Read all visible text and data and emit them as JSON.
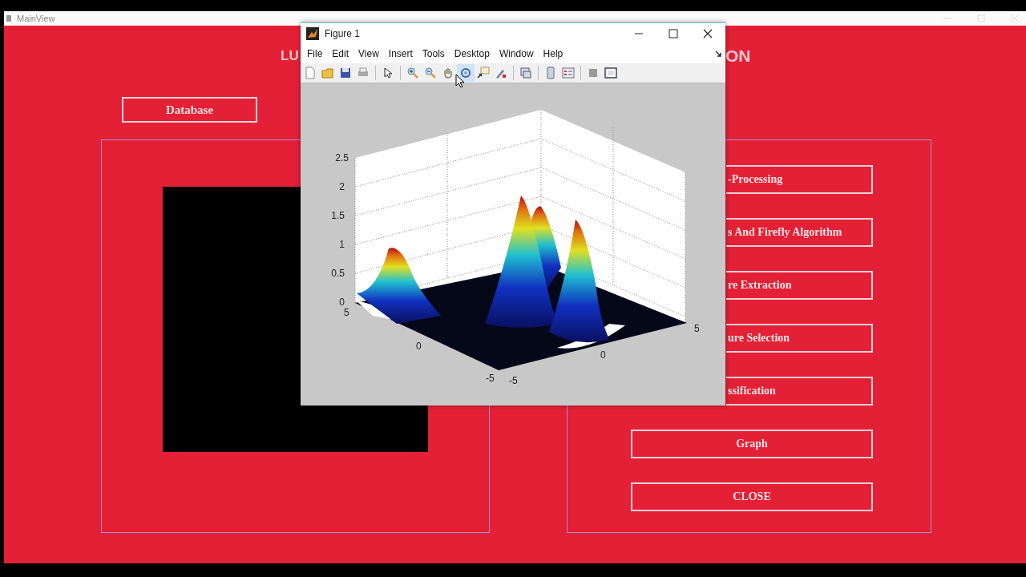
{
  "main_window": {
    "title": "MainView"
  },
  "app_title": {
    "left": "LU",
    "right": "ON"
  },
  "database_button": {
    "label": "Database"
  },
  "actions": [
    {
      "label": "-Processing",
      "covered": true
    },
    {
      "label": "s And Firefly Algorithm",
      "covered": true
    },
    {
      "label": "re Extraction",
      "covered": true
    },
    {
      "label": "ure Selection",
      "covered": true
    },
    {
      "label": "ssification",
      "covered": true
    },
    {
      "label": "Graph",
      "covered": false
    },
    {
      "label": "CLOSE",
      "covered": false
    }
  ],
  "figure": {
    "title": "Figure 1",
    "menu": [
      "File",
      "Edit",
      "View",
      "Insert",
      "Tools",
      "Desktop",
      "Window",
      "Help"
    ],
    "toolbar": [
      {
        "kind": "new",
        "selected": false
      },
      {
        "kind": "open",
        "selected": false
      },
      {
        "kind": "save",
        "selected": false
      },
      {
        "kind": "print",
        "selected": false
      },
      {
        "kind": "separator"
      },
      {
        "kind": "pointer",
        "selected": false
      },
      {
        "kind": "separator"
      },
      {
        "kind": "zoom-in",
        "selected": false
      },
      {
        "kind": "zoom-out",
        "selected": false
      },
      {
        "kind": "pan",
        "selected": false
      },
      {
        "kind": "rotate",
        "selected": true
      },
      {
        "kind": "data-cursor",
        "selected": false
      },
      {
        "kind": "brush",
        "selected": false
      },
      {
        "kind": "separator"
      },
      {
        "kind": "link",
        "selected": false
      },
      {
        "kind": "separator"
      },
      {
        "kind": "colorbar",
        "selected": false
      },
      {
        "kind": "legend",
        "selected": false
      },
      {
        "kind": "separator"
      },
      {
        "kind": "hide-tools",
        "selected": false
      },
      {
        "kind": "show-tools",
        "selected": false
      }
    ],
    "plot": {
      "z_ticks": [
        "2.5",
        "2",
        "1.5",
        "1",
        "0.5",
        "0"
      ],
      "y_ticks": [
        "5",
        "0",
        "-5"
      ],
      "x_ticks": [
        "-5",
        "0",
        "5"
      ]
    }
  }
}
